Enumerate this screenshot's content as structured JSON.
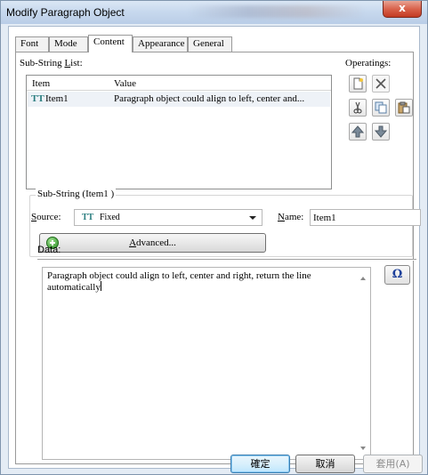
{
  "window": {
    "title": "Modify Paragraph Object",
    "close_label": "x"
  },
  "tabs": [
    {
      "label": "Font"
    },
    {
      "label": "Mode"
    },
    {
      "label": "Content"
    },
    {
      "label": "Appearance"
    },
    {
      "label": "General"
    }
  ],
  "substring_list": {
    "label_prefix": "Sub-String ",
    "label_accel": "L",
    "label_suffix": "ist:",
    "columns": [
      "Item",
      "Value"
    ],
    "rows": [
      {
        "icon_text": "TT",
        "item": "Item1",
        "value": "Paragraph object could align to left, center and..."
      }
    ]
  },
  "operations": {
    "label": "Operatings:",
    "buttons": [
      {
        "name": "new-icon"
      },
      {
        "name": "delete-icon"
      },
      {
        "name": "cut-icon"
      },
      {
        "name": "copy-icon"
      },
      {
        "name": "paste-icon"
      },
      {
        "name": "move-up-icon"
      },
      {
        "name": "move-down-icon"
      }
    ]
  },
  "substring_group": {
    "legend": "Sub-String (Item1 )",
    "source_label_accel": "S",
    "source_label_rest": "ource:",
    "source_icon_text": "TT",
    "source_value": "Fixed",
    "name_label_accel": "N",
    "name_label_rest": "ame:",
    "name_value": "Item1",
    "advanced_accel": "A",
    "advanced_rest": "dvanced..."
  },
  "data": {
    "label": "Data:",
    "text": "Paragraph object could align to left, center and right, return the line automatically",
    "special_char_button": "Ω"
  },
  "footer": {
    "ok_label": "確定",
    "cancel_label": "取消",
    "apply_label": "套用(A)"
  }
}
